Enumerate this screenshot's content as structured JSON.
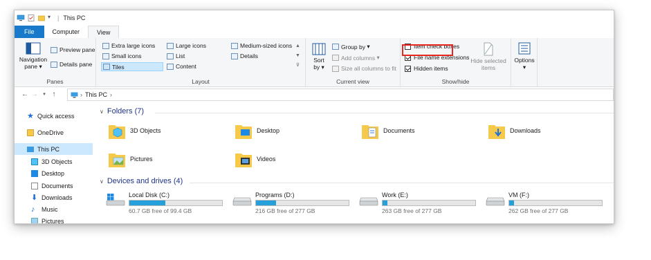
{
  "window": {
    "title": "This PC"
  },
  "tabs": [
    "File",
    "Computer",
    "View"
  ],
  "ribbon": {
    "panes": {
      "label": "Panes",
      "navigation_pane": "Navigation",
      "navigation_pane_2": "pane",
      "preview_pane": "Preview pane",
      "details_pane": "Details pane"
    },
    "layout": {
      "label": "Layout",
      "items": [
        "Extra large icons",
        "Large icons",
        "Medium-sized icons",
        "Small icons",
        "List",
        "Details",
        "Tiles",
        "Content"
      ]
    },
    "current_view": {
      "label": "Current view",
      "sort_by": "Sort",
      "sort_by_2": "by",
      "group_by": "Group by",
      "add_columns": "Add columns",
      "size_columns": "Size all columns to fit"
    },
    "show_hide": {
      "label": "Show/hide",
      "item_check_boxes": "Item check boxes",
      "file_name_extensions": "File name extensions",
      "hidden_items": "Hidden items",
      "hide_selected": "Hide selected",
      "hide_selected_2": "items",
      "options": "Options"
    },
    "checks": {
      "item_check_boxes": false,
      "file_name_extensions": true,
      "hidden_items": true
    }
  },
  "address": {
    "path": "This PC"
  },
  "sidebar": {
    "items": [
      "Quick access",
      "OneDrive",
      "This PC",
      "3D Objects",
      "Desktop",
      "Documents",
      "Downloads",
      "Music",
      "Pictures"
    ]
  },
  "folders": {
    "header": "Folders (7)",
    "items": [
      "3D Objects",
      "Desktop",
      "Documents",
      "Downloads",
      "Pictures",
      "Videos"
    ]
  },
  "drives": {
    "header": "Devices and drives (4)",
    "items": [
      {
        "name": "Local Disk (C:)",
        "free": "60.7 GB free of 99.4 GB",
        "used_fraction": 0.39
      },
      {
        "name": "Programs (D:)",
        "free": "216 GB free of 277 GB",
        "used_fraction": 0.22
      },
      {
        "name": "Work (E:)",
        "free": "263 GB free of 277 GB",
        "used_fraction": 0.05
      },
      {
        "name": "VM (F:)",
        "free": "262 GB free of 277 GB",
        "used_fraction": 0.05
      }
    ]
  },
  "colors": {
    "accent": "#1979ca",
    "highlight": "#e8251f",
    "folder": "#f6c94b",
    "selection": "#cce8ff"
  }
}
